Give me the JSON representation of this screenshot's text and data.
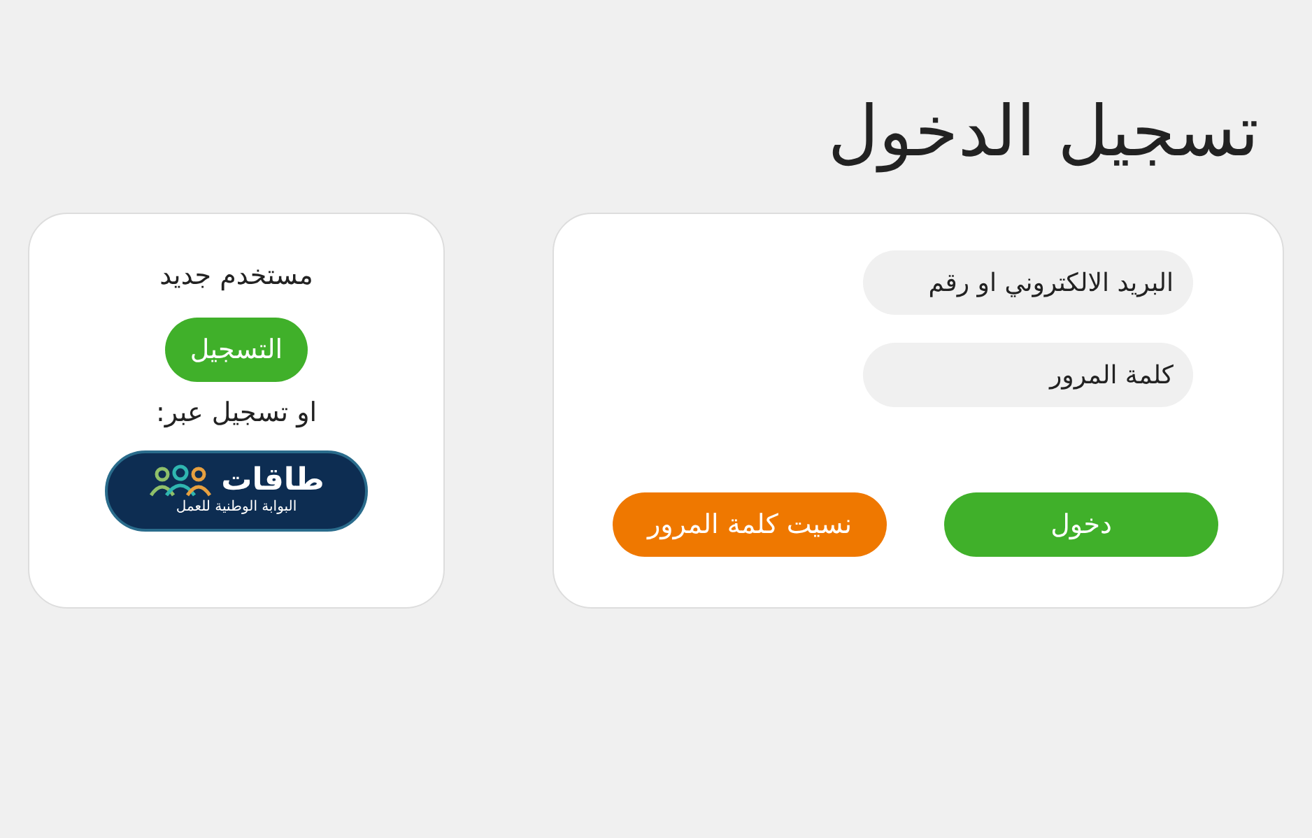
{
  "title": "تسجيل الدخول",
  "login_form": {
    "email_field": {
      "placeholder": "البريد الالكتروني او رقم"
    },
    "password_field": {
      "placeholder": "كلمة المرور"
    },
    "buttons": [
      {
        "kind": "primary",
        "label": "دخول"
      },
      {
        "kind": "warning",
        "label": "نسيت كلمة المرور"
      }
    ]
  },
  "register_panel": {
    "heading": "مستخدم جديد",
    "register_button": "التسجيل",
    "alt_text": "او تسجيل عبر:",
    "portal_logo": {
      "name": "طاقات",
      "subtitle": "البوابة الوطنية للعمل"
    }
  }
}
